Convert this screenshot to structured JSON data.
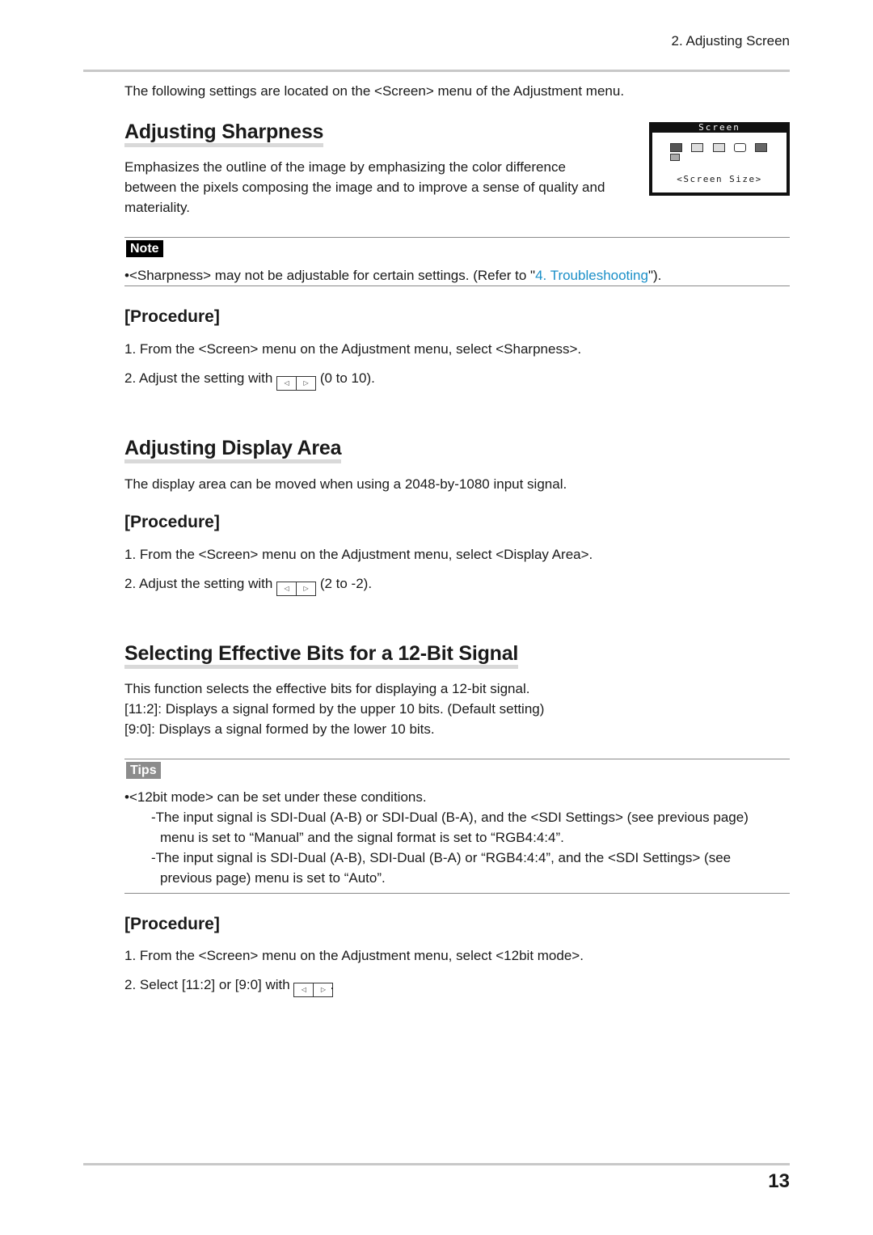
{
  "header": {
    "chapter": "2. Adjusting Screen"
  },
  "intro": "The following settings are located on the <Screen> menu of the Adjustment menu.",
  "osd_menu": {
    "title": "Screen",
    "selected_item": "<Screen Size>",
    "icons": [
      "screen-size-icon",
      "sharpness-icon",
      "smoothing-icon",
      "display-area-icon",
      "bit-mode-icon",
      "return-icon"
    ]
  },
  "sections": {
    "sharpness": {
      "title": "Adjusting Sharpness",
      "description_lines": [
        "Emphasizes the outline of the image by emphasizing the color difference",
        "between the pixels composing the image and to improve a sense of quality and",
        "materiality."
      ],
      "note": {
        "label": "Note",
        "bullet": "•",
        "text_before": "<Sharpness> may not be adjustable for certain settings. (Refer to \"",
        "link": "4. Troubleshooting",
        "text_after": "\")."
      },
      "procedure": {
        "title": "[Procedure]",
        "step1": "1. From the <Screen> menu on the Adjustment menu, select <Sharpness>.",
        "step2_before": "2. Adjust the setting with",
        "step2_after": "(0 to 10)."
      }
    },
    "display_area": {
      "title": "Adjusting Display Area",
      "description": "The display area can be moved when using a 2048-by-1080 input signal.",
      "procedure": {
        "title": "[Procedure]",
        "step1": "1. From the <Screen> menu on the Adjustment menu, select <Display Area>.",
        "step2_before": "2. Adjust the setting with",
        "step2_after": "(2 to -2)."
      }
    },
    "bits": {
      "title": "Selecting Effective Bits for a 12-Bit Signal",
      "description_lines": [
        "This function selects the effective bits for displaying a 12-bit signal.",
        "[11:2]: Displays a signal formed by the upper 10 bits. (Default setting)",
        "[9:0]: Displays a signal formed by the lower 10 bits."
      ],
      "tips": {
        "label": "Tips",
        "bullet": "•",
        "lines": [
          "<12bit mode> can be set under these conditions.",
          "-The input signal is SDI-Dual (A-B) or SDI-Dual (B-A), and the <SDI Settings> (see previous page)",
          "menu is set to “Manual” and the signal format is set to “RGB4:4:4”.",
          "-The input signal is SDI-Dual (A-B), SDI-Dual (B-A) or “RGB4:4:4”, and the <SDI Settings> (see",
          "previous page) menu is set to “Auto”."
        ]
      },
      "procedure": {
        "title": "[Procedure]",
        "step1": "1. From the <Screen> menu on the Adjustment menu, select <12bit mode>.",
        "step2_before": "2. Select [11:2] or [9:0] with",
        "step2_after": "."
      }
    }
  },
  "arrow_keys": {
    "left": "◁",
    "right": "▷"
  },
  "footer": {
    "page_number": "13"
  }
}
